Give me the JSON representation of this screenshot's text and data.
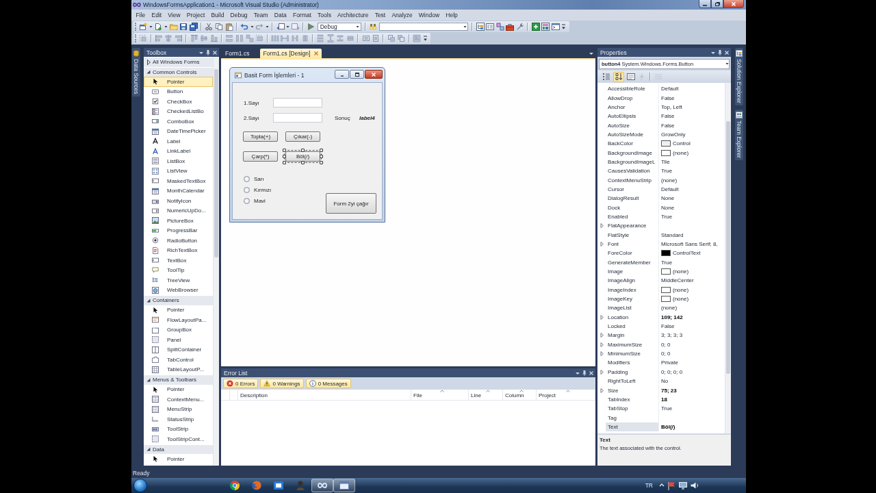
{
  "window": {
    "title": "WindowsFormsApplication1 - Microsoft Visual Studio (Administrator)"
  },
  "menu": [
    "File",
    "Edit",
    "View",
    "Project",
    "Build",
    "Debug",
    "Team",
    "Data",
    "Format",
    "Tools",
    "Architecture",
    "Test",
    "Analyze",
    "Window",
    "Help"
  ],
  "toolbar": {
    "configuration": "Debug"
  },
  "left_dock": [
    "Data Sources"
  ],
  "toolbox": {
    "title": "Toolbox",
    "groups": [
      {
        "label": "All Windows Forms",
        "expanded": false
      },
      {
        "label": "Common Controls",
        "expanded": true,
        "items": [
          {
            "label": "Pointer",
            "selected": true
          },
          {
            "label": "Button",
            "selected": false
          },
          {
            "label": "CheckBox",
            "selected": false
          },
          {
            "label": "CheckedListBo",
            "selected": false
          },
          {
            "label": "ComboBox",
            "selected": false
          },
          {
            "label": "DateTimePicker",
            "selected": false
          },
          {
            "label": "Label",
            "selected": false
          },
          {
            "label": "LinkLabel",
            "selected": false
          },
          {
            "label": "ListBox",
            "selected": false
          },
          {
            "label": "ListView",
            "selected": false
          },
          {
            "label": "MaskedTextBox",
            "selected": false
          },
          {
            "label": "MonthCalendar",
            "selected": false
          },
          {
            "label": "NotifyIcon",
            "selected": false
          },
          {
            "label": "NumericUpDo...",
            "selected": false
          },
          {
            "label": "PictureBox",
            "selected": false
          },
          {
            "label": "ProgressBar",
            "selected": false
          },
          {
            "label": "RadioButton",
            "selected": false
          },
          {
            "label": "RichTextBox",
            "selected": false
          },
          {
            "label": "TextBox",
            "selected": false
          },
          {
            "label": "ToolTip",
            "selected": false
          },
          {
            "label": "TreeView",
            "selected": false
          },
          {
            "label": "WebBrowser",
            "selected": false
          }
        ]
      },
      {
        "label": "Containers",
        "expanded": true,
        "items": [
          {
            "label": "Pointer",
            "selected": false
          },
          {
            "label": "FlowLayoutPa...",
            "selected": false
          },
          {
            "label": "GroupBox",
            "selected": false
          },
          {
            "label": "Panel",
            "selected": false
          },
          {
            "label": "SplitContainer",
            "selected": false
          },
          {
            "label": "TabControl",
            "selected": false
          },
          {
            "label": "TableLayoutP...",
            "selected": false
          }
        ]
      },
      {
        "label": "Menus & Toolbars",
        "expanded": true,
        "items": [
          {
            "label": "Pointer",
            "selected": false
          },
          {
            "label": "ContextMenu...",
            "selected": false
          },
          {
            "label": "MenuStrip",
            "selected": false
          },
          {
            "label": "StatusStrip",
            "selected": false
          },
          {
            "label": "ToolStrip",
            "selected": false
          },
          {
            "label": "ToolStripCont...",
            "selected": false
          }
        ]
      },
      {
        "label": "Data",
        "expanded": true,
        "items": [
          {
            "label": "Pointer",
            "selected": false
          }
        ]
      }
    ]
  },
  "designer": {
    "tabs": [
      {
        "label": "Form1.cs",
        "selected": false
      },
      {
        "label": "Form1.cs [Design]",
        "selected": true
      }
    ],
    "form": {
      "title": "Basit Form İşlemleri - 1",
      "fields": [
        {
          "label": "1.Sayı"
        },
        {
          "label": "2.Sayı"
        }
      ],
      "result": {
        "label": "Sonuç",
        "value": "label4"
      },
      "buttons": [
        {
          "label": "Topla(+)",
          "selected": false
        },
        {
          "label": "Çıkar(-)",
          "selected": false
        },
        {
          "label": "Çarp(*)",
          "selected": false
        },
        {
          "label": "Böl(/)",
          "selected": true
        }
      ],
      "radios": [
        {
          "label": "Sarı",
          "checked": false
        },
        {
          "label": "Kırmızı",
          "checked": false
        },
        {
          "label": "Mavi",
          "checked": false
        }
      ],
      "call_button": "Form 2yi çağır"
    }
  },
  "error_list": {
    "title": "Error List",
    "filters": [
      {
        "label": "0 Errors",
        "kind": "error",
        "selected": true
      },
      {
        "label": "0 Warnings",
        "kind": "warning",
        "selected": true
      },
      {
        "label": "0 Messages",
        "kind": "message",
        "selected": true
      }
    ],
    "columns": [
      "Description",
      "File",
      "Line",
      "Column",
      "Project"
    ]
  },
  "properties": {
    "title": "Properties",
    "object": {
      "name": "button4",
      "type": "System.Windows.Forms.Button"
    },
    "views": [
      {
        "kind": "categorized",
        "selected": false
      },
      {
        "kind": "alphabetical",
        "selected": true
      },
      {
        "kind": "property_pages",
        "selected": false
      }
    ],
    "rows": [
      {
        "name": "AccessibleRole",
        "value": "Default",
        "expandable": false,
        "modified": false,
        "selected": false
      },
      {
        "name": "AllowDrop",
        "value": "False",
        "expandable": false,
        "modified": false,
        "selected": false
      },
      {
        "name": "Anchor",
        "value": "Top, Left",
        "expandable": false,
        "modified": false,
        "selected": false
      },
      {
        "name": "AutoEllipsis",
        "value": "False",
        "expandable": false,
        "modified": false,
        "selected": false
      },
      {
        "name": "AutoSize",
        "value": "False",
        "expandable": false,
        "modified": false,
        "selected": false
      },
      {
        "name": "AutoSizeMode",
        "value": "GrowOnly",
        "expandable": false,
        "modified": false,
        "selected": false
      },
      {
        "name": "BackColor",
        "value": "Control",
        "color": "#f0f0f0",
        "expandable": false,
        "modified": false,
        "selected": false
      },
      {
        "name": "BackgroundImage",
        "value": "(none)",
        "color": "#ffffff",
        "expandable": false,
        "modified": false,
        "selected": false
      },
      {
        "name": "BackgroundImageL",
        "value": "Tile",
        "expandable": false,
        "modified": false,
        "selected": false
      },
      {
        "name": "CausesValidation",
        "value": "True",
        "expandable": false,
        "modified": false,
        "selected": false
      },
      {
        "name": "ContextMenuStrip",
        "value": "(none)",
        "expandable": false,
        "modified": false,
        "selected": false
      },
      {
        "name": "Cursor",
        "value": "Default",
        "expandable": false,
        "modified": false,
        "selected": false
      },
      {
        "name": "DialogResult",
        "value": "None",
        "expandable": false,
        "modified": false,
        "selected": false
      },
      {
        "name": "Dock",
        "value": "None",
        "expandable": false,
        "modified": false,
        "selected": false
      },
      {
        "name": "Enabled",
        "value": "True",
        "expandable": false,
        "modified": false,
        "selected": false
      },
      {
        "name": "FlatAppearance",
        "expandable": true,
        "selected": false
      },
      {
        "name": "FlatStyle",
        "value": "Standard",
        "expandable": false,
        "modified": false,
        "selected": false
      },
      {
        "name": "Font",
        "value": "Microsoft Sans Serif; 8,",
        "expandable": true,
        "modified": false,
        "selected": false
      },
      {
        "name": "ForeColor",
        "value": "ControlText",
        "color": "#000000",
        "expandable": false,
        "modified": false,
        "selected": false
      },
      {
        "name": "GenerateMember",
        "value": "True",
        "expandable": false,
        "modified": false,
        "selected": false
      },
      {
        "name": "Image",
        "value": "(none)",
        "color": "#ffffff",
        "expandable": false,
        "modified": false,
        "selected": false
      },
      {
        "name": "ImageAlign",
        "value": "MiddleCenter",
        "expandable": false,
        "modified": false,
        "selected": false
      },
      {
        "name": "ImageIndex",
        "value": "(none)",
        "color": "#ffffff",
        "expandable": false,
        "modified": false,
        "selected": false
      },
      {
        "name": "ImageKey",
        "value": "(none)",
        "color": "#ffffff",
        "expandable": false,
        "modified": false,
        "selected": false
      },
      {
        "name": "ImageList",
        "value": "(none)",
        "expandable": false,
        "modified": false,
        "selected": false
      },
      {
        "name": "Location",
        "value": "109; 142",
        "expandable": true,
        "modified": true,
        "selected": false
      },
      {
        "name": "Locked",
        "value": "False",
        "expandable": false,
        "modified": false,
        "selected": false
      },
      {
        "name": "Margin",
        "value": "3; 3; 3; 3",
        "expandable": true,
        "modified": false,
        "selected": false
      },
      {
        "name": "MaximumSize",
        "value": "0; 0",
        "expandable": true,
        "modified": false,
        "selected": false
      },
      {
        "name": "MinimumSize",
        "value": "0; 0",
        "expandable": true,
        "modified": false,
        "selected": false
      },
      {
        "name": "Modifiers",
        "value": "Private",
        "expandable": false,
        "modified": false,
        "selected": false
      },
      {
        "name": "Padding",
        "value": "0; 0; 0; 0",
        "expandable": true,
        "modified": false,
        "selected": false
      },
      {
        "name": "RightToLeft",
        "value": "No",
        "expandable": false,
        "modified": false,
        "selected": false
      },
      {
        "name": "Size",
        "value": "75; 23",
        "expandable": true,
        "modified": true,
        "selected": false
      },
      {
        "name": "TabIndex",
        "value": "18",
        "expandable": false,
        "modified": true,
        "selected": false
      },
      {
        "name": "TabStop",
        "value": "True",
        "expandable": false,
        "modified": false,
        "selected": false
      },
      {
        "name": "Tag",
        "expandable": false,
        "selected": false
      },
      {
        "name": "Text",
        "value": "Böl(/)",
        "expandable": false,
        "modified": true,
        "selected": true
      }
    ],
    "description": {
      "title": "Text",
      "text": "The text associated with the control."
    }
  },
  "right_dock": [
    "Solution Explorer",
    "Team Explorer"
  ],
  "status_bar": "Ready",
  "taskbar": {
    "apps": [
      {
        "running": false
      },
      {
        "running": false
      },
      {
        "running": false
      },
      {
        "running": false
      },
      {
        "running": true
      },
      {
        "running": true
      }
    ],
    "language": "TR"
  }
}
